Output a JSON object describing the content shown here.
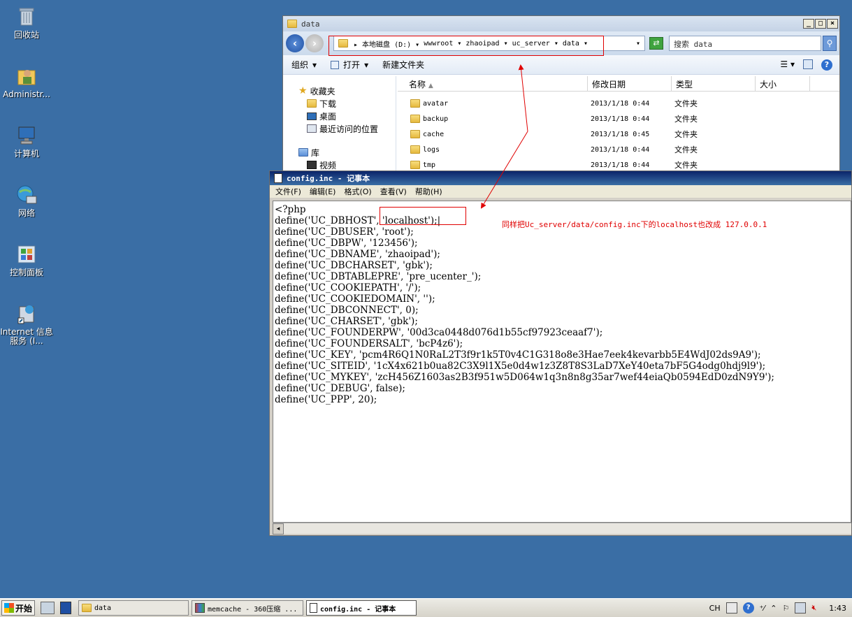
{
  "desktop": {
    "icons": [
      {
        "label": "回收站"
      },
      {
        "label": "Administr..."
      },
      {
        "label": "计算机"
      },
      {
        "label": "网络"
      },
      {
        "label": "控制面板"
      },
      {
        "label": "Internet 信息服务 (I..."
      }
    ]
  },
  "explorer": {
    "title": "data",
    "breadcrumb": [
      "本地磁盘 (D:)",
      "wwwroot",
      "zhaoipad",
      "uc_server",
      "data"
    ],
    "search_placeholder": "搜索 data",
    "toolbar": {
      "organize": "组织",
      "open": "打开",
      "new_folder": "新建文件夹"
    },
    "nav": {
      "favorites": "收藏夹",
      "downloads": "下载",
      "desktop": "桌面",
      "recent": "最近访问的位置",
      "libraries": "库",
      "videos": "视频"
    },
    "columns": {
      "name": "名称",
      "modified": "修改日期",
      "type": "类型",
      "size": "大小"
    },
    "files": [
      {
        "name": "avatar",
        "date": "2013/1/18 0:44",
        "type": "文件夹"
      },
      {
        "name": "backup",
        "date": "2013/1/18 0:44",
        "type": "文件夹"
      },
      {
        "name": "cache",
        "date": "2013/1/18 0:45",
        "type": "文件夹"
      },
      {
        "name": "logs",
        "date": "2013/1/18 0:44",
        "type": "文件夹"
      },
      {
        "name": "tmp",
        "date": "2013/1/18 0:44",
        "type": "文件夹"
      }
    ]
  },
  "notepad": {
    "title": "config.inc - 记事本",
    "menu": {
      "file": "文件(F)",
      "edit": "编辑(E)",
      "format": "格式(O)",
      "view": "查看(V)",
      "help": "帮助(H)"
    },
    "content": "<?php\ndefine('UC_DBHOST', 'localhost');|\ndefine('UC_DBUSER', 'root');\ndefine('UC_DBPW', '123456');\ndefine('UC_DBNAME', 'zhaoipad');\ndefine('UC_DBCHARSET', 'gbk');\ndefine('UC_DBTABLEPRE', 'pre_ucenter_');\ndefine('UC_COOKIEPATH', '/');\ndefine('UC_COOKIEDOMAIN', '');\ndefine('UC_DBCONNECT', 0);\ndefine('UC_CHARSET', 'gbk');\ndefine('UC_FOUNDERPW', '00d3ca0448d076d1b55cf97923ceaaf7');\ndefine('UC_FOUNDERSALT', 'bcP4z6');\ndefine('UC_KEY', 'pcm4R6Q1N0RaL2T3f9r1k5T0v4C1G318o8e3Hae7eek4kevarbb5E4WdJ02ds9A9');\ndefine('UC_SITEID', '1cX4x621b0ua82C3X9l1X5e0d4w1z3Z8T8S3LaD7XeY40eta7bF5G4odg0hdj9l9');\ndefine('UC_MYKEY', 'zcH456Z1603as2B3f951w5D064w1q3n8n8g35ar7wef44eiaQb0594EdD0zdN9Y9');\ndefine('UC_DEBUG', false);\ndefine('UC_PPP', 20);",
    "annotation": "同样把Uc_server/data/config.inc下的localhost也改成 127.0.0.1"
  },
  "taskbar": {
    "start": "开始",
    "tasks": [
      "data",
      "memcache - 360压缩 ...",
      "config.inc - 记事本"
    ],
    "lang": "CH",
    "clock": "1:43"
  }
}
